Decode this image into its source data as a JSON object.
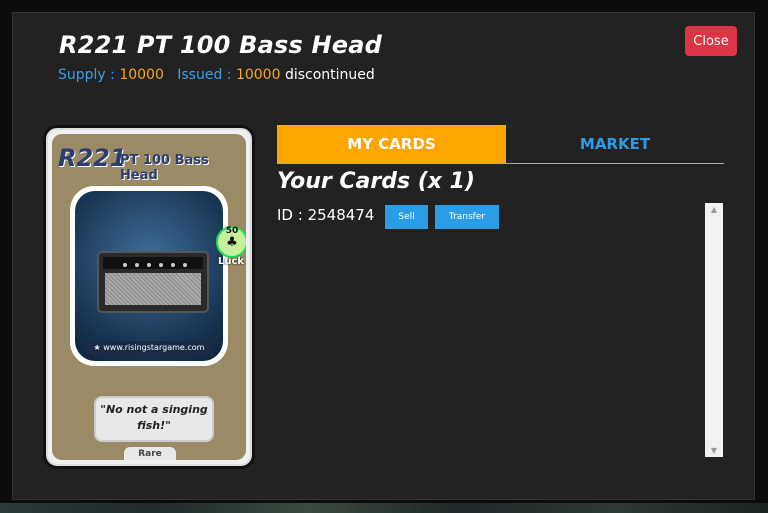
{
  "header": {
    "title": "R221 PT 100 Bass Head",
    "supply_label": "Supply : ",
    "supply_value": "10000",
    "issued_label": "Issued : ",
    "issued_value": "10000",
    "status": "discontinued",
    "close_label": "Close"
  },
  "card": {
    "code": "R221",
    "name": "PT 100 Bass Head",
    "website": "www.risingstargame.com",
    "luck_value": "50",
    "luck_label": "Luck",
    "quote": "\"No not a singing fish!\"",
    "rarity": "Rare"
  },
  "tabs": [
    {
      "label": "MY CARDS",
      "active": true
    },
    {
      "label": "MARKET",
      "active": false
    }
  ],
  "your_cards": {
    "heading": "Your Cards (x 1)",
    "items": [
      {
        "id_text": "ID : 2548474",
        "sell_label": "Sell",
        "transfer_label": "Transfer"
      }
    ]
  },
  "colors": {
    "accent_orange": "#ffa500",
    "link_blue": "#2d9ce6",
    "close_red": "#dc3545",
    "modal_bg": "#222222"
  },
  "icons": {
    "clover": "clover-icon",
    "star": "star-icon",
    "scroll_up": "chevron-up-icon",
    "scroll_down": "chevron-down-icon"
  }
}
